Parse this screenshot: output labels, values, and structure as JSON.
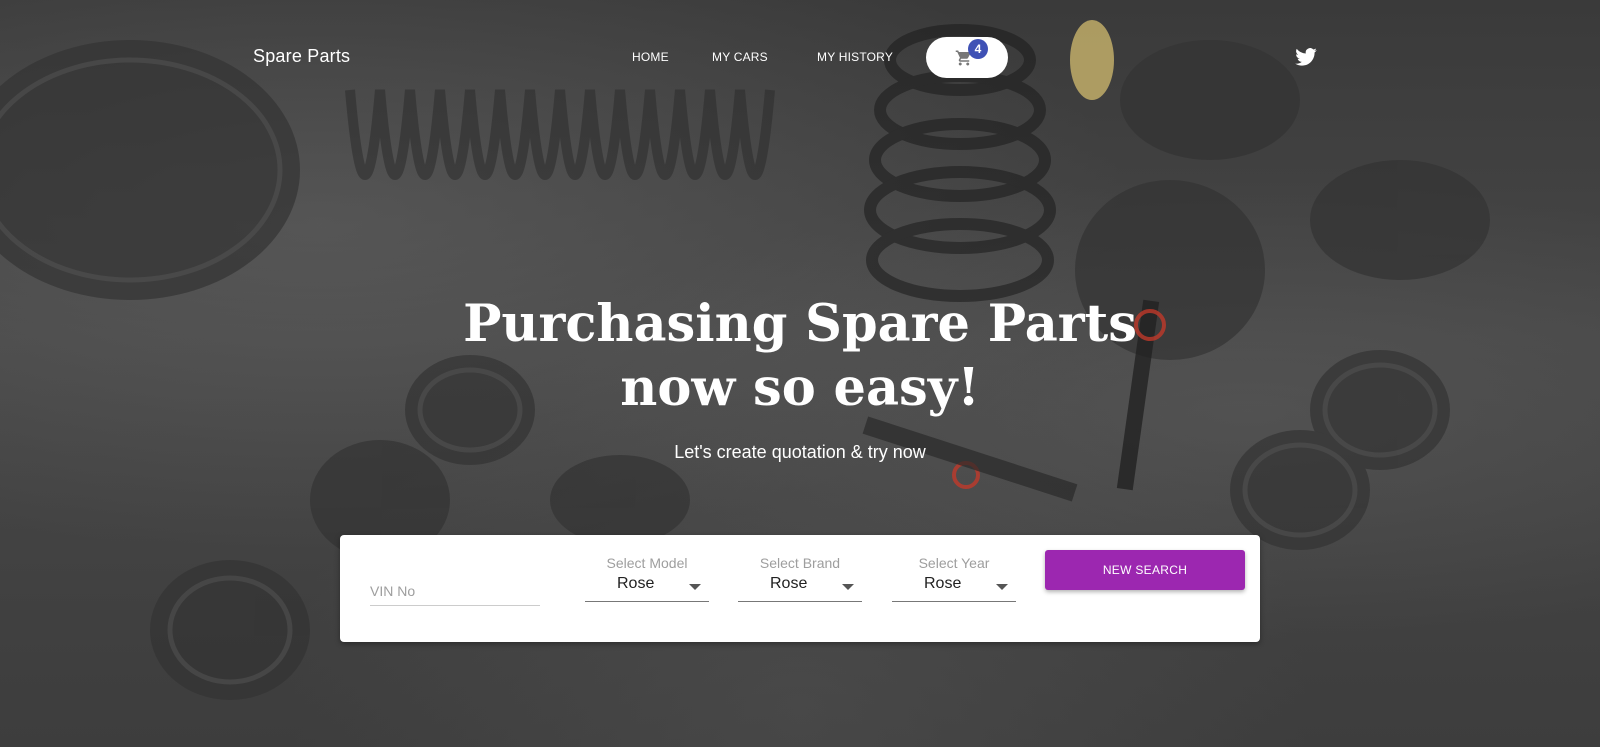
{
  "brand": "Spare Parts",
  "nav": {
    "home": "HOME",
    "my_cars": "MY CARS",
    "my_history": "MY HISTORY",
    "cart_count": "4",
    "cart_icon": "shopping-cart-icon",
    "social_icon": "twitter-icon"
  },
  "hero": {
    "title_line1": "Purchasing Spare Parts",
    "title_line2": "now so easy!",
    "subtitle": "Let's create quotation & try now"
  },
  "search": {
    "vin_placeholder": "VIN No",
    "model": {
      "label": "Select Model",
      "value": "Rose"
    },
    "brand": {
      "label": "Select Brand",
      "value": "Rose"
    },
    "year": {
      "label": "Select Year",
      "value": "Rose"
    },
    "button_label": "NEW SEARCH"
  },
  "colors": {
    "accent": "#9c27b0",
    "badge": "#3f51b5",
    "background": "#424242"
  }
}
